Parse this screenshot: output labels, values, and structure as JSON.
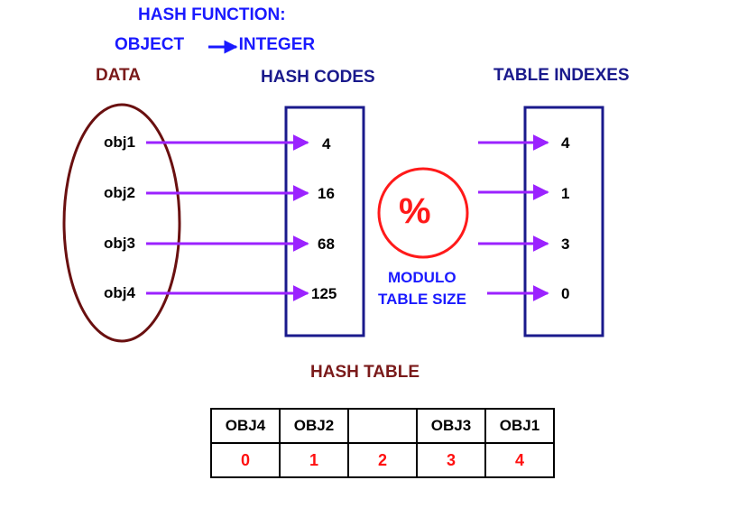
{
  "title": {
    "line1": "HASH FUNCTION:",
    "object": "OBJECT",
    "integer": "INTEGER"
  },
  "headers": {
    "data": "DATA",
    "hash_codes": "HASH CODES",
    "table_indexes": "TABLE INDEXES"
  },
  "objects": [
    "obj1",
    "obj2",
    "obj3",
    "obj4"
  ],
  "hash_codes": [
    "4",
    "16",
    "68",
    "125"
  ],
  "table_indexes": [
    "4",
    "1",
    "3",
    "0"
  ],
  "modulo": {
    "symbol": "%",
    "line1": "MODULO",
    "line2": "TABLE SIZE"
  },
  "hash_table": {
    "title": "HASH TABLE",
    "slots": [
      "OBJ4",
      "OBJ2",
      "",
      "OBJ3",
      "OBJ1"
    ],
    "indexes": [
      "0",
      "1",
      "2",
      "3",
      "4"
    ]
  },
  "colors": {
    "arrow": "#9b22ff",
    "box": "#1a1a8c",
    "ellipse": "#6a1010",
    "circle": "#ff1a1a",
    "blue_text": "#1a1aff",
    "maroon_text": "#7a1a1a",
    "index_red": "#ff1010"
  }
}
